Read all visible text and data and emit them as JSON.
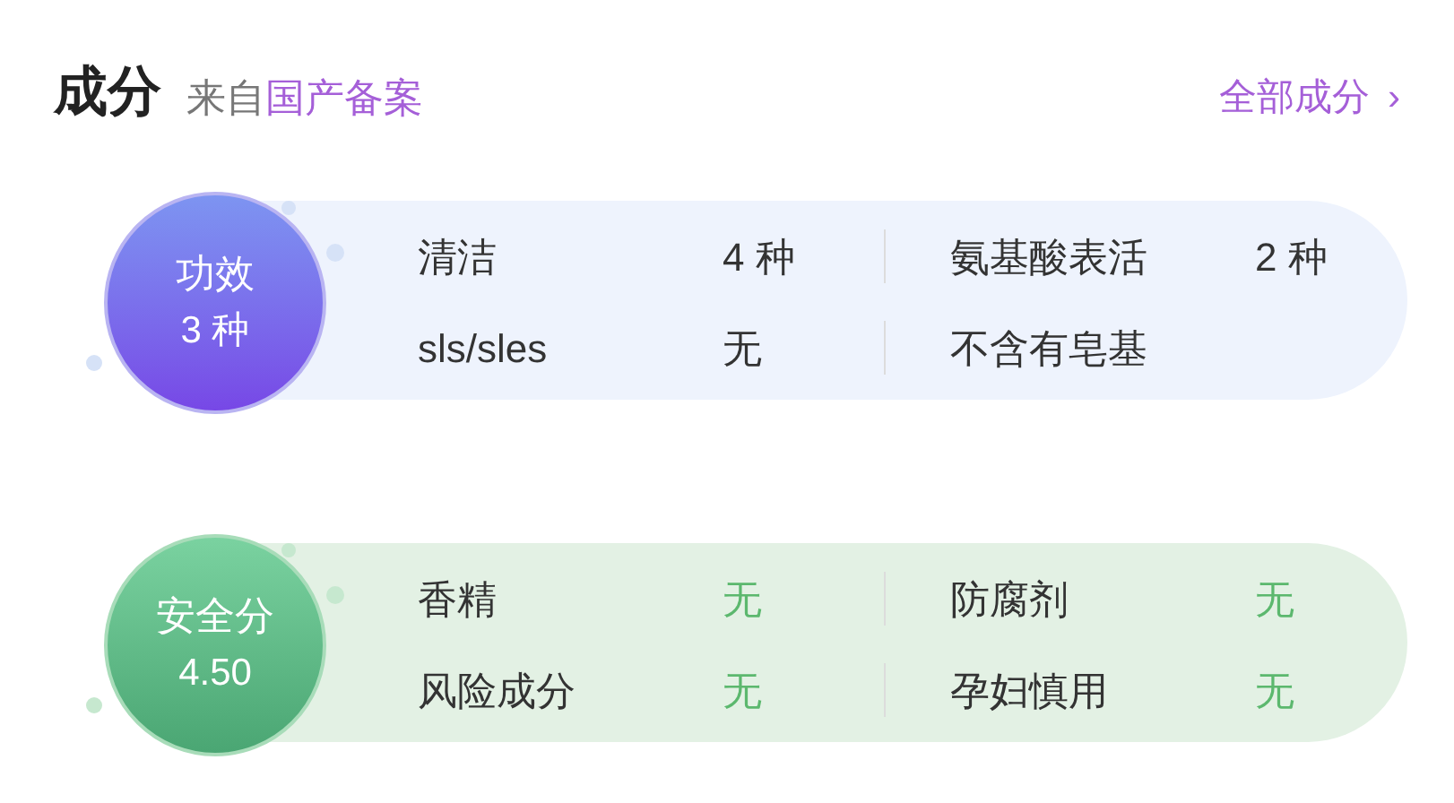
{
  "header": {
    "title": "成分",
    "source_prefix": "来自",
    "source": "国产备案",
    "link": "全部成分",
    "link_arrow": "›"
  },
  "cards": [
    {
      "kind": "efficacy",
      "badge_title": "功效",
      "badge_value": "3 种",
      "rows": [
        [
          {
            "label": "清洁",
            "value": "4 种",
            "color": "#333333"
          },
          {
            "label": "氨基酸表活",
            "value": "2 种",
            "color": "#333333"
          }
        ],
        [
          {
            "label": "sls/sles",
            "value": "无",
            "color": "#333333"
          },
          {
            "label": "不含有皂基"
          }
        ]
      ]
    },
    {
      "kind": "safety",
      "badge_title": "安全分",
      "badge_value": "4.50",
      "rows": [
        [
          {
            "label": "香精",
            "value": "无",
            "color": "#5cb86e"
          },
          {
            "label": "防腐剂",
            "value": "无",
            "color": "#5cb86e"
          }
        ],
        [
          {
            "label": "风险成分",
            "value": "无",
            "color": "#5cb86e"
          },
          {
            "label": "孕妇慎用",
            "value": "无",
            "color": "#5cb86e"
          }
        ]
      ]
    }
  ]
}
